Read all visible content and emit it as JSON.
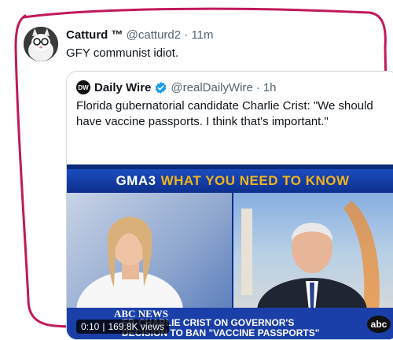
{
  "tweet": {
    "display_name": "Catturd ™",
    "handle": "@catturd2",
    "separator": "·",
    "time": "11m",
    "text": "GFY communist idiot."
  },
  "quoted_tweet": {
    "logo_text": "DW",
    "display_name": "Daily Wire",
    "handle": "@realDailyWire",
    "separator": "·",
    "time": "1h",
    "text": "Florida gubernatorial candidate Charlie Crist: \"We should have vaccine passports. I think that's important.\""
  },
  "video": {
    "banner_prefix": "GMA3",
    "banner_title": "WHAT YOU NEED TO KNOW",
    "network_tag": "ABC NEWS",
    "headline": "EP. CHARLIE CRIST ON GOVERNOR'S DECISION TO BAN \"VACCINE PASSPORTS\"",
    "abc_logo": "abc",
    "timestamp": "0:10",
    "views": "169.8K views",
    "pill_separator": "|"
  },
  "colors": {
    "outline": "#c2185b",
    "banner_yellow": "#f4b41a",
    "verified_blue": "#1d9bf0"
  },
  "icons": [
    "verified-badge-icon",
    "daily-wire-logo-icon",
    "abc-logo-icon"
  ]
}
